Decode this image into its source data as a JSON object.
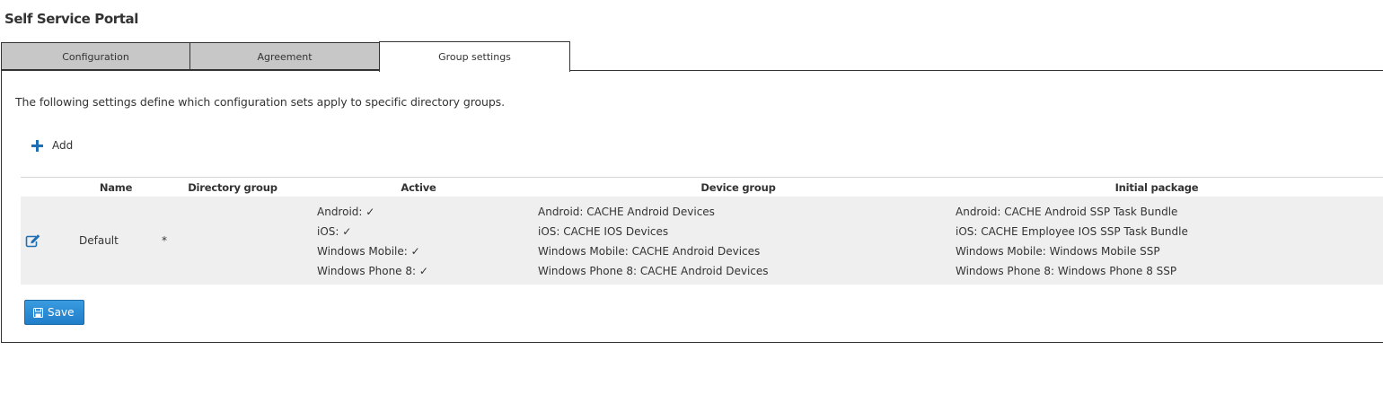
{
  "page": {
    "title": "Self Service Portal"
  },
  "tabs": [
    {
      "label": "Configuration",
      "active": false
    },
    {
      "label": "Agreement",
      "active": false
    },
    {
      "label": "Group settings",
      "active": true
    }
  ],
  "panel": {
    "intro": "The following settings define which configuration sets apply to specific directory groups.",
    "add_label": "Add",
    "save_label": "Save"
  },
  "table": {
    "columns": {
      "name": "Name",
      "directory_group": "Directory group",
      "active": "Active",
      "device_group": "Device group",
      "initial_package": "Initial package"
    },
    "rows": [
      {
        "name": "Default",
        "directory_group": "*",
        "active": [
          "Android: ✓",
          "iOS: ✓",
          "Windows Mobile: ✓",
          "Windows Phone 8: ✓"
        ],
        "device_group": [
          "Android: CACHE Android Devices",
          "iOS: CACHE IOS Devices",
          "Windows Mobile: CACHE Android Devices",
          "Windows Phone 8: CACHE Android Devices"
        ],
        "initial_package": [
          "Android: CACHE Android SSP Task Bundle",
          "iOS: CACHE Employee IOS SSP Task Bundle",
          "Windows Mobile: Windows Mobile SSP",
          "Windows Phone 8: Windows Phone 8 SSP"
        ]
      }
    ]
  },
  "colors": {
    "accent": "#1e6fb5",
    "button": "#2b8ad4",
    "inactive_tab": "#c7c7c7",
    "row_background": "#efefef"
  },
  "icons": {
    "add": "plus-icon",
    "edit": "edit-icon",
    "save": "floppy-disk-icon"
  }
}
